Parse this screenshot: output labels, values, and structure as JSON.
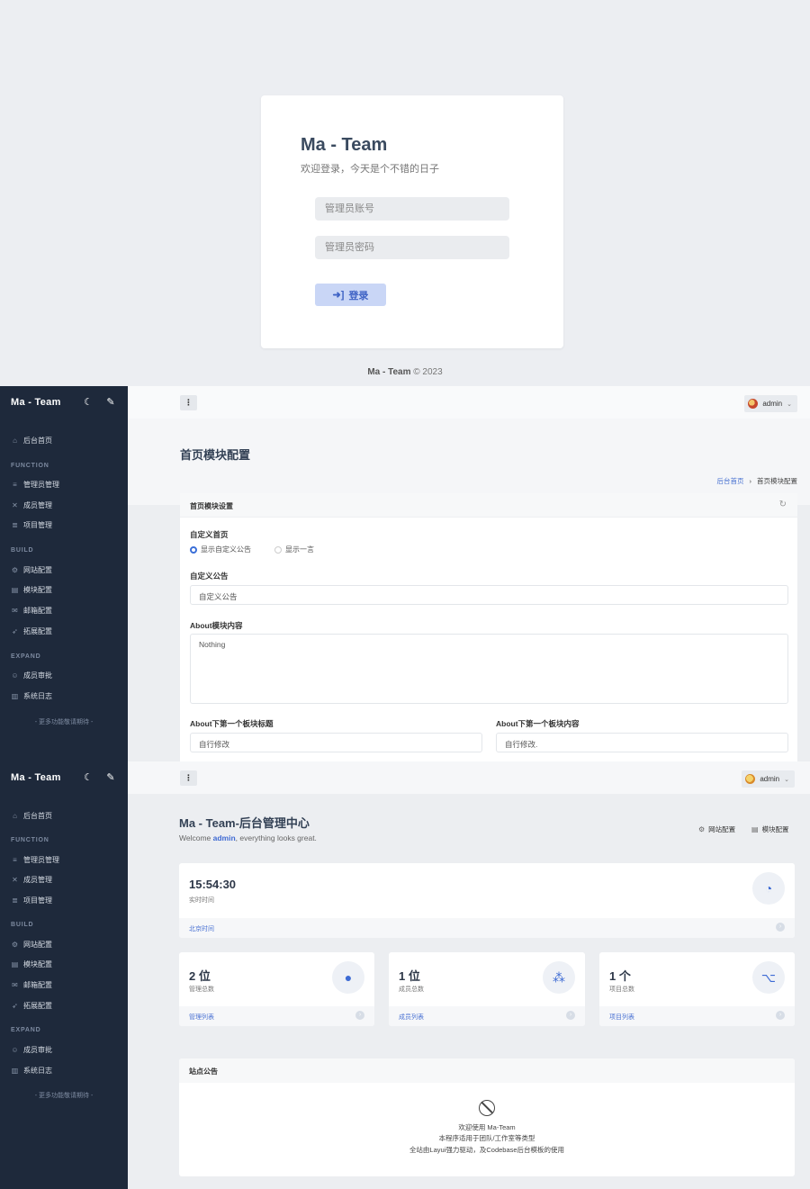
{
  "login": {
    "title": "Ma - Team",
    "subtitle": "欢迎登录，今天是个不错的日子",
    "username_placeholder": "管理员账号",
    "password_placeholder": "管理员密码",
    "login_label": "登录",
    "footer_brand": "Ma - Team",
    "footer_rest": "© 2023"
  },
  "sidebar": {
    "brand": "Ma - Team",
    "home": "后台首页",
    "group_function": "FUNCTION",
    "admin_manage": "管理员管理",
    "member_manage": "成员管理",
    "project_manage": "项目管理",
    "group_build": "BUILD",
    "site_config": "网站配置",
    "module_config": "模块配置",
    "mail_config": "邮箱配置",
    "ext_config": "拓展配置",
    "group_expand": "EXPAND",
    "member_review": "成员审批",
    "system_log": "系统日志",
    "more": "- 更多功能敬请期待 -"
  },
  "topbar": {
    "menu_glyph": "⋮",
    "username": "admin"
  },
  "module_page": {
    "title": "首页模块配置",
    "breadcrumb_home": "后台首页",
    "breadcrumb_current": "首页模块配置",
    "panel_title": "首页模块设置",
    "custom_home_label": "自定义首页",
    "radio_custom_notice": "显示自定义公告",
    "radio_one_word": "显示一言",
    "custom_notice_label": "自定义公告",
    "custom_notice_value": "自定义公告",
    "about_label": "About模块内容",
    "about_value": "Nothing",
    "block_title_label": "About下第一个板块标题",
    "block_title_value": "自行修改",
    "block_content_label": "About下第一个板块内容",
    "block_content_value": "自行修改."
  },
  "dashboard": {
    "title": "Ma - Team-后台管理中心",
    "welcome_pre": "Welcome ",
    "welcome_user": "admin",
    "welcome_post": ", everything looks great.",
    "quick_site": "网站配置",
    "quick_module": "模块配置",
    "time_value": "15:54:30",
    "time_label": "实时时间",
    "time_link": "北京时间",
    "admin_count": "2 位",
    "admin_label": "管理总数",
    "admin_link": "管理列表",
    "member_count": "1 位",
    "member_label": "成员总数",
    "member_link": "成员列表",
    "project_count": "1 个",
    "project_label": "项目总数",
    "project_link": "项目列表",
    "notice_title": "站点公告",
    "notice_line1": "欢迎使用 Ma-Team",
    "notice_line2": "本程序适用于团队/工作室等类型",
    "notice_line3": "全站由Layui强力驱动，及Codebase后台模板的使用"
  }
}
